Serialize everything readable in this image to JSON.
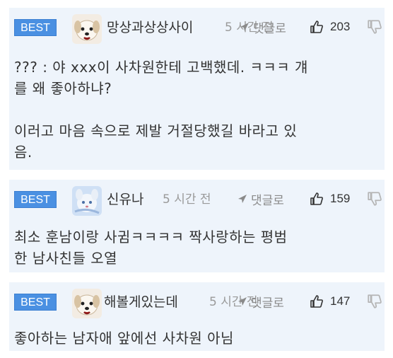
{
  "comments": [
    {
      "badge": "BEST",
      "nickname": "망상과상상사이",
      "time": "5 시간 전",
      "reply_label": "댓글로",
      "likes": "203",
      "body": [
        "??? : 야 xxx이 사차원한테 고백했데. ㅋㅋㅋ 걔",
        "를 왜 좋아하냐?",
        "",
        "이러고 마음 속으로 제발 거절당했길 바라고 있",
        "음."
      ]
    },
    {
      "badge": "BEST",
      "nickname": "신유나",
      "time": "5 시간 전",
      "reply_label": "댓글로",
      "likes": "159",
      "body": [
        "최소 훈남이랑 사귐ㅋㅋㅋㅋ 짝사랑하는 평범",
        "한 남사친들 오열"
      ]
    },
    {
      "badge": "BEST",
      "nickname": "해볼게있는데",
      "time": "5 시간 전",
      "reply_label": "댓글로",
      "likes": "147",
      "body": [
        "좋아하는 남자애 앞에선 사차원 아님"
      ]
    }
  ],
  "icons": {
    "reply": "reply-arrow-icon",
    "like": "thumbs-up-icon",
    "dislike": "thumbs-down-icon"
  },
  "colors": {
    "card_bg": "#eef4fb",
    "badge_bg": "#4a90e2",
    "text": "#333333",
    "meta": "#9a9a9a"
  }
}
